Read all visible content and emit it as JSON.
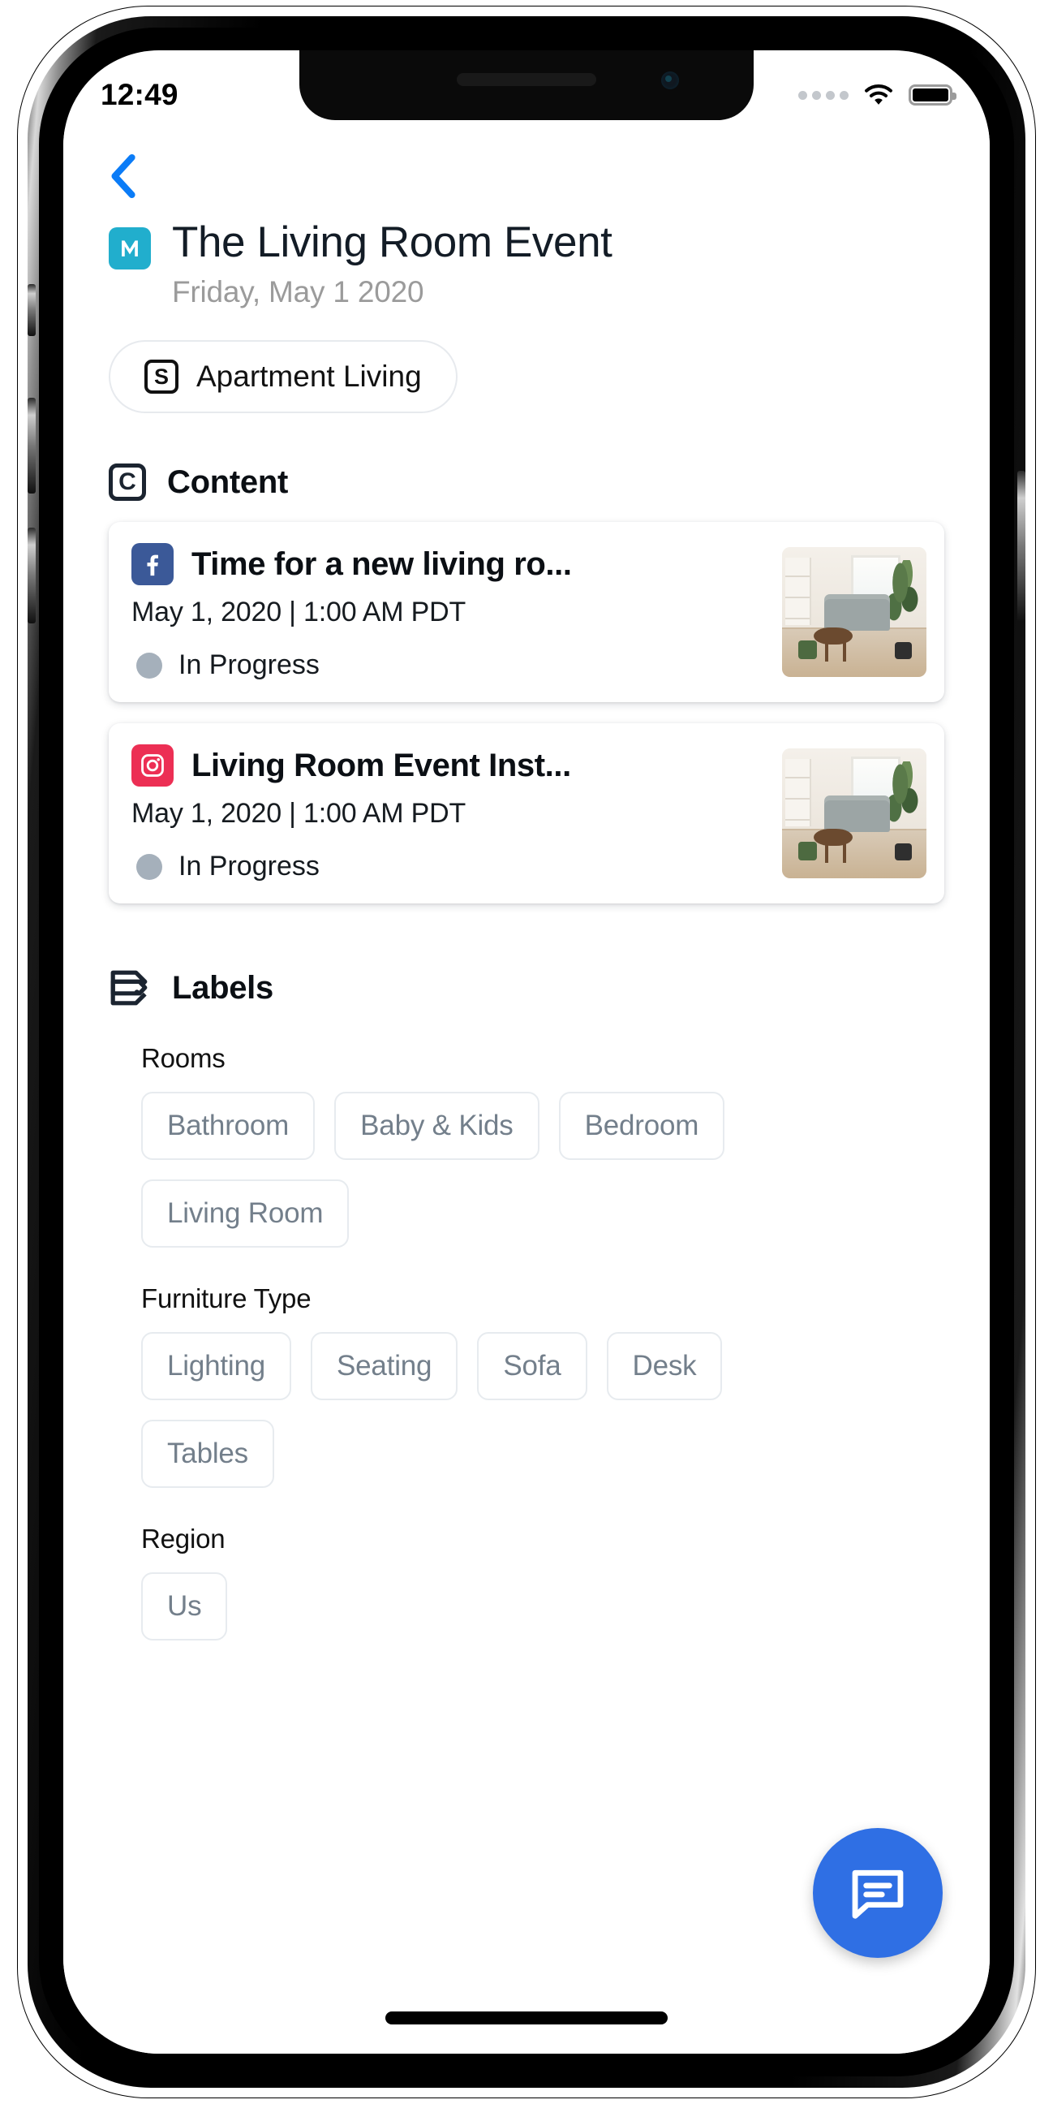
{
  "status_bar": {
    "time": "12:49",
    "signal_icon": "signal-dots-icon",
    "wifi_icon": "wifi-icon",
    "battery_icon": "battery-full-icon"
  },
  "nav": {
    "back_icon": "chevron-left-icon"
  },
  "header": {
    "app_badge_icon": "m-app-logo-icon",
    "app_badge_color": "#21aecd",
    "title": "The Living Room Event",
    "subtitle": "Friday, May 1 2020",
    "campaign_chip": {
      "icon": "s-square-icon",
      "icon_letter": "S",
      "label": "Apartment Living"
    }
  },
  "content_section": {
    "icon": "c-square-icon",
    "icon_letter": "C",
    "title": "Content",
    "items": [
      {
        "network": "facebook",
        "network_icon": "facebook-icon",
        "network_color": "#3b5998",
        "title": "Time for a new living ro...",
        "date": "May 1, 2020 | 1:00 AM PDT",
        "status": "In Progress",
        "status_color": "#a5b0bb",
        "thumbnail": "living-room-photo"
      },
      {
        "network": "instagram",
        "network_icon": "instagram-icon",
        "network_color": "#ec2f54",
        "title": "Living Room Event Inst...",
        "date": "May 1, 2020 | 1:00 AM PDT",
        "status": "In Progress",
        "status_color": "#a5b0bb",
        "thumbnail": "living-room-photo"
      }
    ]
  },
  "labels_section": {
    "icon": "tag-icon",
    "title": "Labels",
    "groups": [
      {
        "name": "Rooms",
        "tags": [
          "Bathroom",
          "Baby & Kids",
          "Bedroom",
          "Living Room"
        ]
      },
      {
        "name": "Furniture Type",
        "tags": [
          "Lighting",
          "Seating",
          "Sofa",
          "Desk",
          "Tables"
        ]
      },
      {
        "name": "Region",
        "tags": [
          "Us"
        ]
      }
    ]
  },
  "fab": {
    "icon": "chat-bubble-icon",
    "color": "#2f6fe4"
  }
}
